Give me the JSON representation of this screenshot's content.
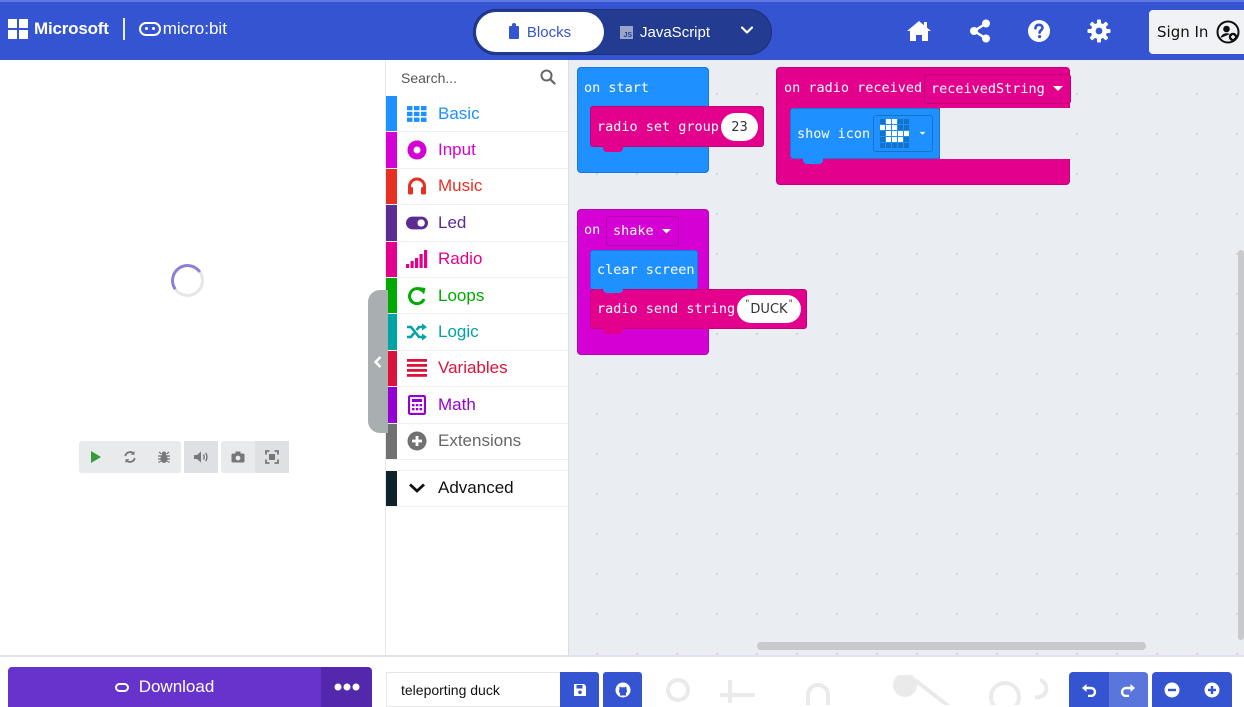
{
  "header": {
    "microsoft_label": "Microsoft",
    "product_label": "micro:bit",
    "editor_tabs": [
      {
        "label": "Blocks",
        "active": true,
        "icon": "puzzle-icon"
      },
      {
        "label": "JavaScript",
        "active": false,
        "icon": "js-icon"
      }
    ],
    "more_languages_icon": "chevron-down-icon",
    "icons": [
      "home-icon",
      "share-icon",
      "help-icon",
      "settings-icon"
    ],
    "sign_in_label": "Sign In",
    "accent_color": "#3454D1"
  },
  "simulator": {
    "status": "loading",
    "controls": [
      "play-icon",
      "restart-icon",
      "debug-icon",
      "mute-icon",
      "screenshot-icon",
      "fullscreen-icon"
    ]
  },
  "toolbox": {
    "search_placeholder": "Search...",
    "categories": [
      {
        "label": "Basic",
        "color": "#1E90FF",
        "icon": "grid-icon"
      },
      {
        "label": "Input",
        "color": "#D400D4",
        "icon": "target-icon"
      },
      {
        "label": "Music",
        "color": "#E63022",
        "icon": "headphones-icon"
      },
      {
        "label": "Led",
        "color": "#5C2D91",
        "icon": "toggle-icon"
      },
      {
        "label": "Radio",
        "color": "#E3008C",
        "icon": "signal-icon"
      },
      {
        "label": "Loops",
        "color": "#00AA00",
        "icon": "loop-icon"
      },
      {
        "label": "Logic",
        "color": "#00A4A6",
        "icon": "shuffle-icon"
      },
      {
        "label": "Variables",
        "color": "#DC143C",
        "icon": "list-icon"
      },
      {
        "label": "Math",
        "color": "#9400D3",
        "icon": "calculator-icon"
      },
      {
        "label": "Extensions",
        "color": "#717171",
        "icon": "plus-circle-icon"
      }
    ],
    "advanced": {
      "label": "Advanced",
      "color": "#0d242c",
      "icon": "chevron-down-icon"
    }
  },
  "workspace": {
    "blocks": {
      "on_start": {
        "label": "on start",
        "color": "#1E90FF",
        "child": {
          "label": "radio set group",
          "value": "23",
          "color": "#E3008C"
        }
      },
      "on_radio_received": {
        "label": "on radio received",
        "param": "receivedString",
        "color": "#E3008C",
        "child": {
          "label": "show icon",
          "color": "#1E90FF",
          "led_pattern": [
            [
              0,
              1,
              1,
              0,
              0
            ],
            [
              1,
              1,
              1,
              0,
              0
            ],
            [
              0,
              1,
              1,
              1,
              1
            ],
            [
              0,
              1,
              1,
              1,
              0
            ],
            [
              0,
              0,
              0,
              0,
              0
            ]
          ]
        }
      },
      "on_shake": {
        "label": "on",
        "event": "shake",
        "color": "#D400D4",
        "children": [
          {
            "label": "clear screen",
            "color": "#1E90FF"
          },
          {
            "label": "radio send string",
            "value": "DUCK",
            "color": "#E3008C"
          }
        ]
      }
    }
  },
  "footer": {
    "download_label": "Download",
    "more_icon": "ellipsis-icon",
    "project_name": "teleporting duck",
    "save_icon": "save-icon",
    "github_icon": "github-icon",
    "undo_icon": "undo-icon",
    "redo_icon": "redo-icon",
    "zoom_out_icon": "zoom-out-icon",
    "zoom_in_icon": "zoom-in-icon",
    "download_color": "#6633CC"
  }
}
